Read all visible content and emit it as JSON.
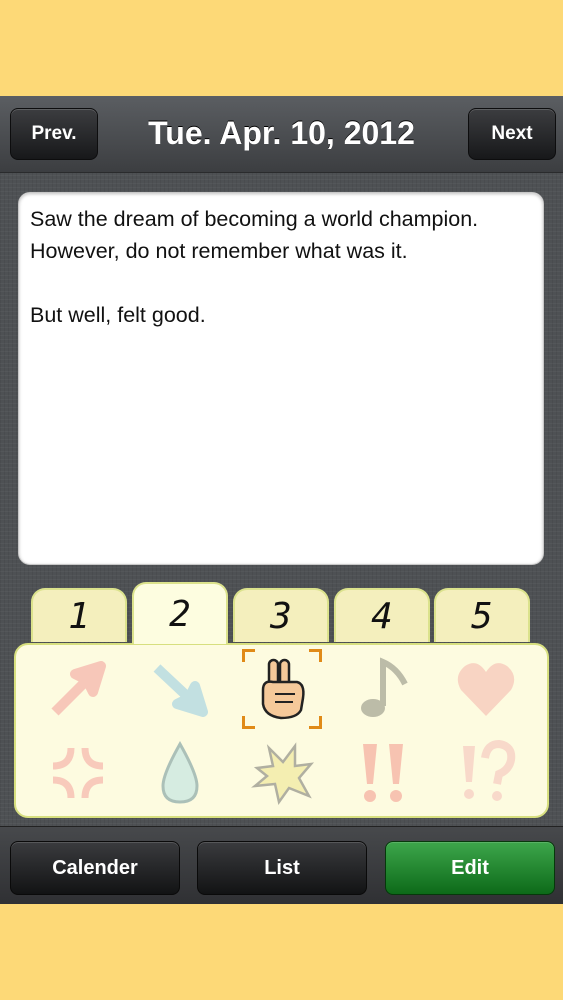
{
  "header": {
    "prev_label": "Prev.",
    "date": "Tue. Apr. 10, 2012",
    "next_label": "Next"
  },
  "note": {
    "text": "Saw the dream of becoming a world champion.\nHowever, do not remember what was it.\n\nBut well, felt good."
  },
  "tabs": [
    "1",
    "2",
    "3",
    "4",
    "5"
  ],
  "active_tab": "2",
  "stickers": [
    {
      "icon": "arrow-up-right-icon",
      "color": "#f08a8a"
    },
    {
      "icon": "arrow-down-right-icon",
      "color": "#7cc0e4"
    },
    {
      "icon": "peace-hand-icon",
      "color": "#f5c99a",
      "selected": true
    },
    {
      "icon": "music-note-icon",
      "color": "#9a9a90"
    },
    {
      "icon": "heart-icon",
      "color": "#f4a7a0"
    },
    {
      "icon": "anger-mark-icon",
      "color": "#f29090"
    },
    {
      "icon": "water-drop-icon",
      "color": "#a8dce4"
    },
    {
      "icon": "burst-icon",
      "color": "#eae07a"
    },
    {
      "icon": "double-exclamation-icon",
      "color": "#f1807a"
    },
    {
      "icon": "exclamation-question-icon",
      "color": "#f4b0b0"
    }
  ],
  "footer": {
    "calender_label": "Calender",
    "list_label": "List",
    "edit_label": "Edit"
  },
  "colors": {
    "background": "#fdd977",
    "edit_button": "#1f8a2d",
    "selection": "#e08a17"
  }
}
